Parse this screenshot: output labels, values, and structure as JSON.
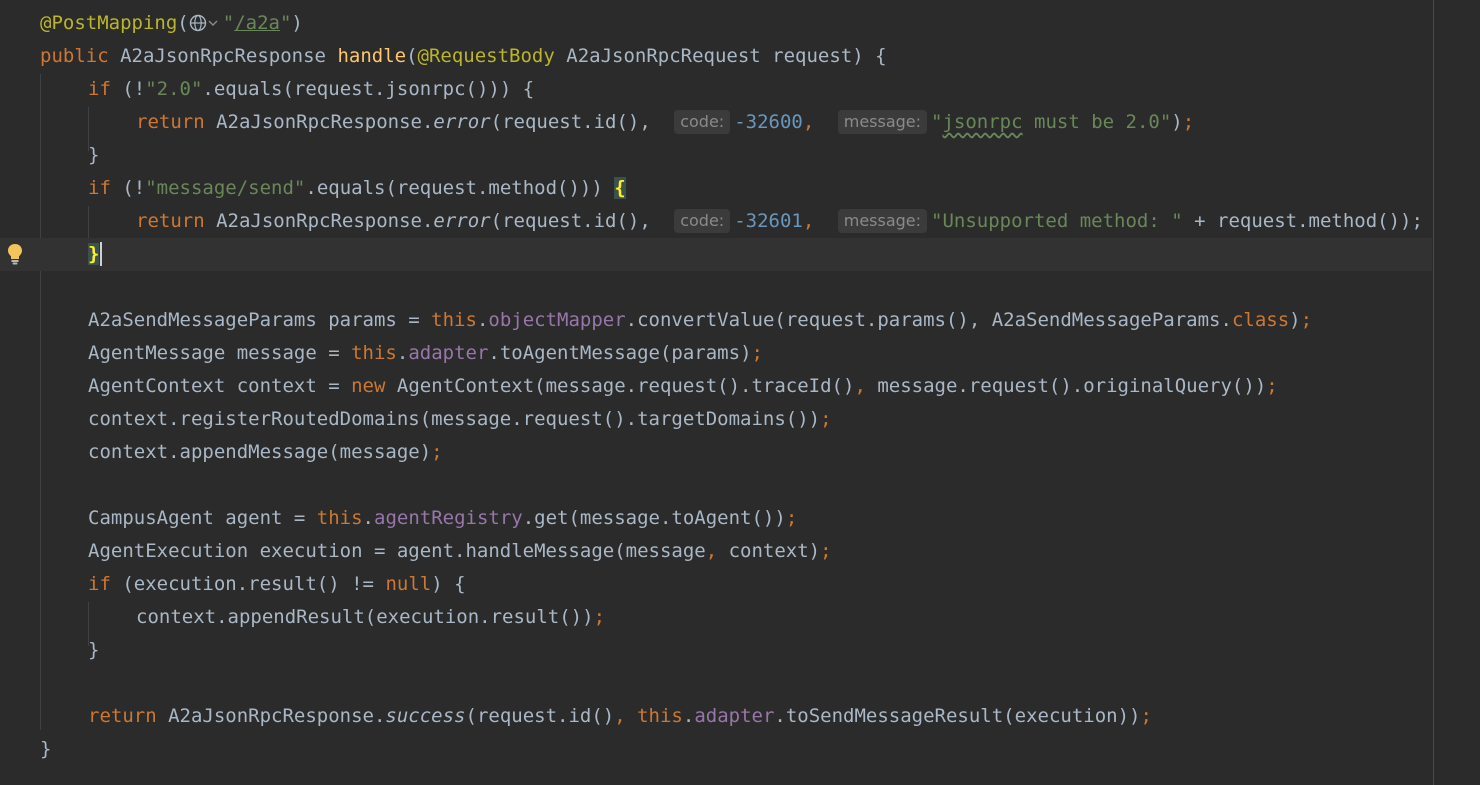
{
  "editor": {
    "language": "Java",
    "hints": {
      "code": "code:",
      "message": "message:"
    },
    "lines": {
      "l1": {
        "ann": "@PostMapping",
        "open": "(",
        "q1": "\"",
        "path": "/a2a",
        "q2": "\"",
        "close": ")"
      },
      "l2": {
        "kw": "public",
        "type": "A2aJsonRpcResponse",
        "method": "handle",
        "paren": "(",
        "ann": "@RequestBody",
        "rest": " A2aJsonRpcRequest request) {"
      },
      "l3": {
        "kw": "if",
        "pre": " (!",
        "str": "\"2.0\"",
        "rest": ".equals(request.jsonrpc())) {"
      },
      "l4": {
        "kw": "return",
        "pre": " A2aJsonRpcResponse.",
        "fn": "error",
        "args": "(request.id(), ",
        "num": "-32600",
        "comma": ", ",
        "q1": "\"",
        "sq": "jsonrpc",
        "str_rest": " must be 2.0\"",
        "close": ")",
        "semi": ";"
      },
      "l5": {
        "brace": "}"
      },
      "l6": {
        "kw": "if",
        "pre": " (!",
        "str": "\"message/send\"",
        "rest": ".equals(request.method())) ",
        "brace": "{"
      },
      "l7": {
        "kw": "return",
        "pre": " A2aJsonRpcResponse.",
        "fn": "error",
        "args": "(request.id(), ",
        "num": "-32601",
        "comma": ", ",
        "str": "\"Unsupported method: \"",
        "rest": " + request.method());"
      },
      "l8": {
        "brace": "}"
      },
      "l10": {
        "pre": "A2aSendMessageParams params = ",
        "kw": "this",
        "dot": ".",
        "field": "objectMapper",
        "rest": ".convertValue(request.params(), A2aSendMessageParams.",
        "kw2": "class",
        "close": ")",
        "semi": ";"
      },
      "l11": {
        "pre": "AgentMessage message = ",
        "kw": "this",
        "dot": ".",
        "field": "adapter",
        "rest": ".toAgentMessage(params)",
        "semi": ";"
      },
      "l12": {
        "pre": "AgentContext context = ",
        "kw": "new",
        "rest": " AgentContext(message.request().traceId()",
        "comma": ", ",
        "rest2": "message.request().originalQuery())",
        "semi": ";"
      },
      "l13": {
        "text": "context.registerRoutedDomains(message.request().targetDomains())",
        "semi": ";"
      },
      "l14": {
        "text": "context.appendMessage(message)",
        "semi": ";"
      },
      "l16": {
        "pre": "CampusAgent agent = ",
        "kw": "this",
        "dot": ".",
        "field": "agentRegistry",
        "rest": ".get(message.toAgent())",
        "semi": ";"
      },
      "l17": {
        "pre": "AgentExecution execution = agent.handleMessage(message",
        "comma": ", ",
        "rest": "context)",
        "semi": ";"
      },
      "l18": {
        "kw": "if",
        "pre": " (execution.result() != ",
        "kw2": "null",
        "rest": ") {"
      },
      "l19": {
        "text": "context.appendResult(execution.result())",
        "semi": ";"
      },
      "l20": {
        "brace": "}"
      },
      "l22": {
        "kw": "return",
        "pre": " A2aJsonRpcResponse.",
        "fn": "success",
        "args": "(request.id()",
        "comma": ", ",
        "kw2": "this",
        "dot": ".",
        "field": "adapter",
        "rest": ".toSendMessageResult(execution))",
        "semi": ";"
      },
      "l23": {
        "brace": "}"
      }
    },
    "colors": {
      "background": "#2b2b2b",
      "keyword": "#cc7832",
      "string": "#6a8759",
      "number": "#6897bb",
      "annotation": "#bbb529",
      "field": "#9876aa",
      "default": "#a9b7c6"
    }
  }
}
